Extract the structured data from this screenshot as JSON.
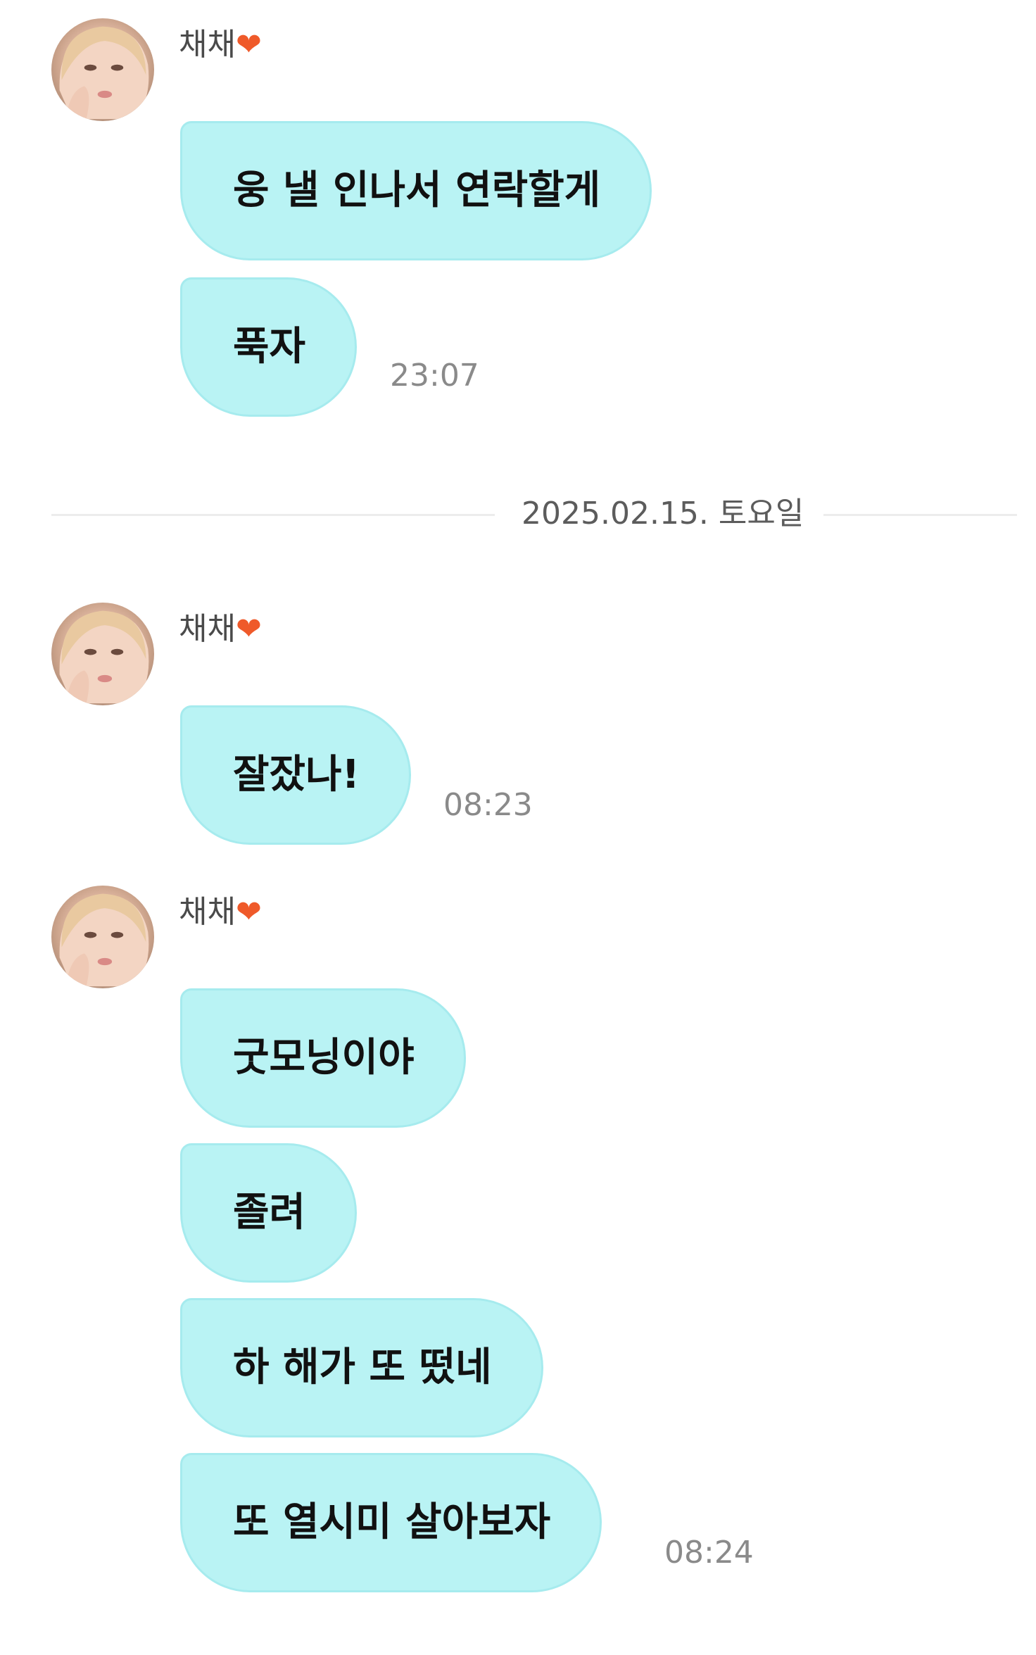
{
  "groups": [
    {
      "sender": "채채",
      "sender_emoji": "❤",
      "messages": [
        "웅 낼 인나서 연락할게",
        "푹자"
      ],
      "time": "23:07"
    },
    {
      "sender": "채채",
      "sender_emoji": "❤",
      "messages": [
        "잘잤나!"
      ],
      "time": "08:23"
    },
    {
      "sender": "채채",
      "sender_emoji": "❤",
      "messages": [
        "굿모닝이야",
        "졸려",
        "하 해가 또 떴네",
        "또 열시미 살아보자"
      ],
      "time": "08:24"
    }
  ],
  "date_divider": "2025.02.15. 토요일",
  "colors": {
    "bubble": "#b9f3f4",
    "bubble_border": "#a6ebee",
    "heart": "#ef5a2a",
    "timestamp": "#8a8a8a"
  },
  "icons": {
    "avatar": "profile-photo",
    "heart": "orange-heart-emoji"
  }
}
